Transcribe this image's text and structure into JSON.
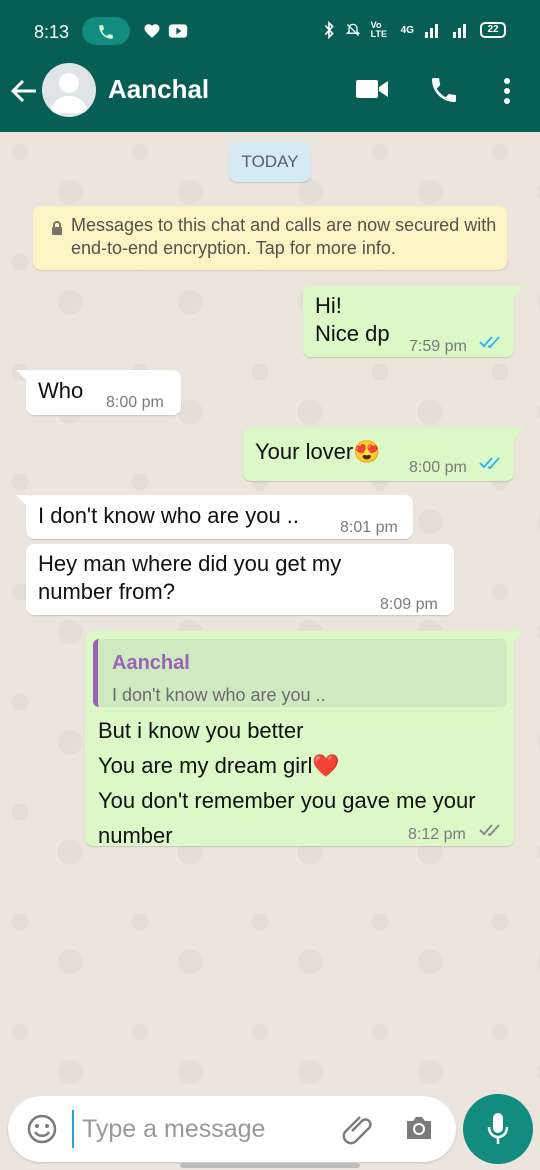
{
  "status_bar": {
    "time": "8:13",
    "battery": "22",
    "network_label": "4G",
    "volte_label": "Vo LTE"
  },
  "header": {
    "contact_name": "Aanchal"
  },
  "chat": {
    "date_divider": "TODAY",
    "encryption_notice": "Messages to this chat and calls are now secured with end-to-end encryption. Tap for more info."
  },
  "messages": [
    {
      "direction": "outgoing",
      "text": "Hi!\nNice dp",
      "time": "7:59 pm",
      "status": "read"
    },
    {
      "direction": "incoming",
      "text": "Who",
      "time": "8:00 pm"
    },
    {
      "direction": "outgoing",
      "text": "Your lover😍",
      "time": "8:00 pm",
      "status": "read"
    },
    {
      "direction": "incoming",
      "text": "I don't know who are you ..",
      "time": "8:01 pm"
    },
    {
      "direction": "incoming",
      "text": "Hey man where did you get my number from?",
      "time": "8:09 pm"
    },
    {
      "direction": "outgoing",
      "reply_to": {
        "sender": "Aanchal",
        "text": "I don't know who are you .."
      },
      "text": "But i know you better\nYou are my dream girl❤️\nYou don't remember you gave me your number",
      "time": "8:12 pm",
      "status": "delivered"
    }
  ],
  "composer": {
    "placeholder": "Type a message"
  },
  "colors": {
    "header": "#075e54",
    "accent": "#128c7e",
    "outgoing_bubble": "#dcf8c6",
    "incoming_bubble": "#ffffff",
    "read_tick": "#34b7f1"
  },
  "icons": {
    "back": "back-arrow-icon",
    "video": "video-call-icon",
    "call": "phone-call-icon",
    "more": "more-vertical-icon",
    "emoji": "emoji-icon",
    "attach": "paperclip-icon",
    "camera": "camera-icon",
    "mic": "microphone-icon"
  }
}
